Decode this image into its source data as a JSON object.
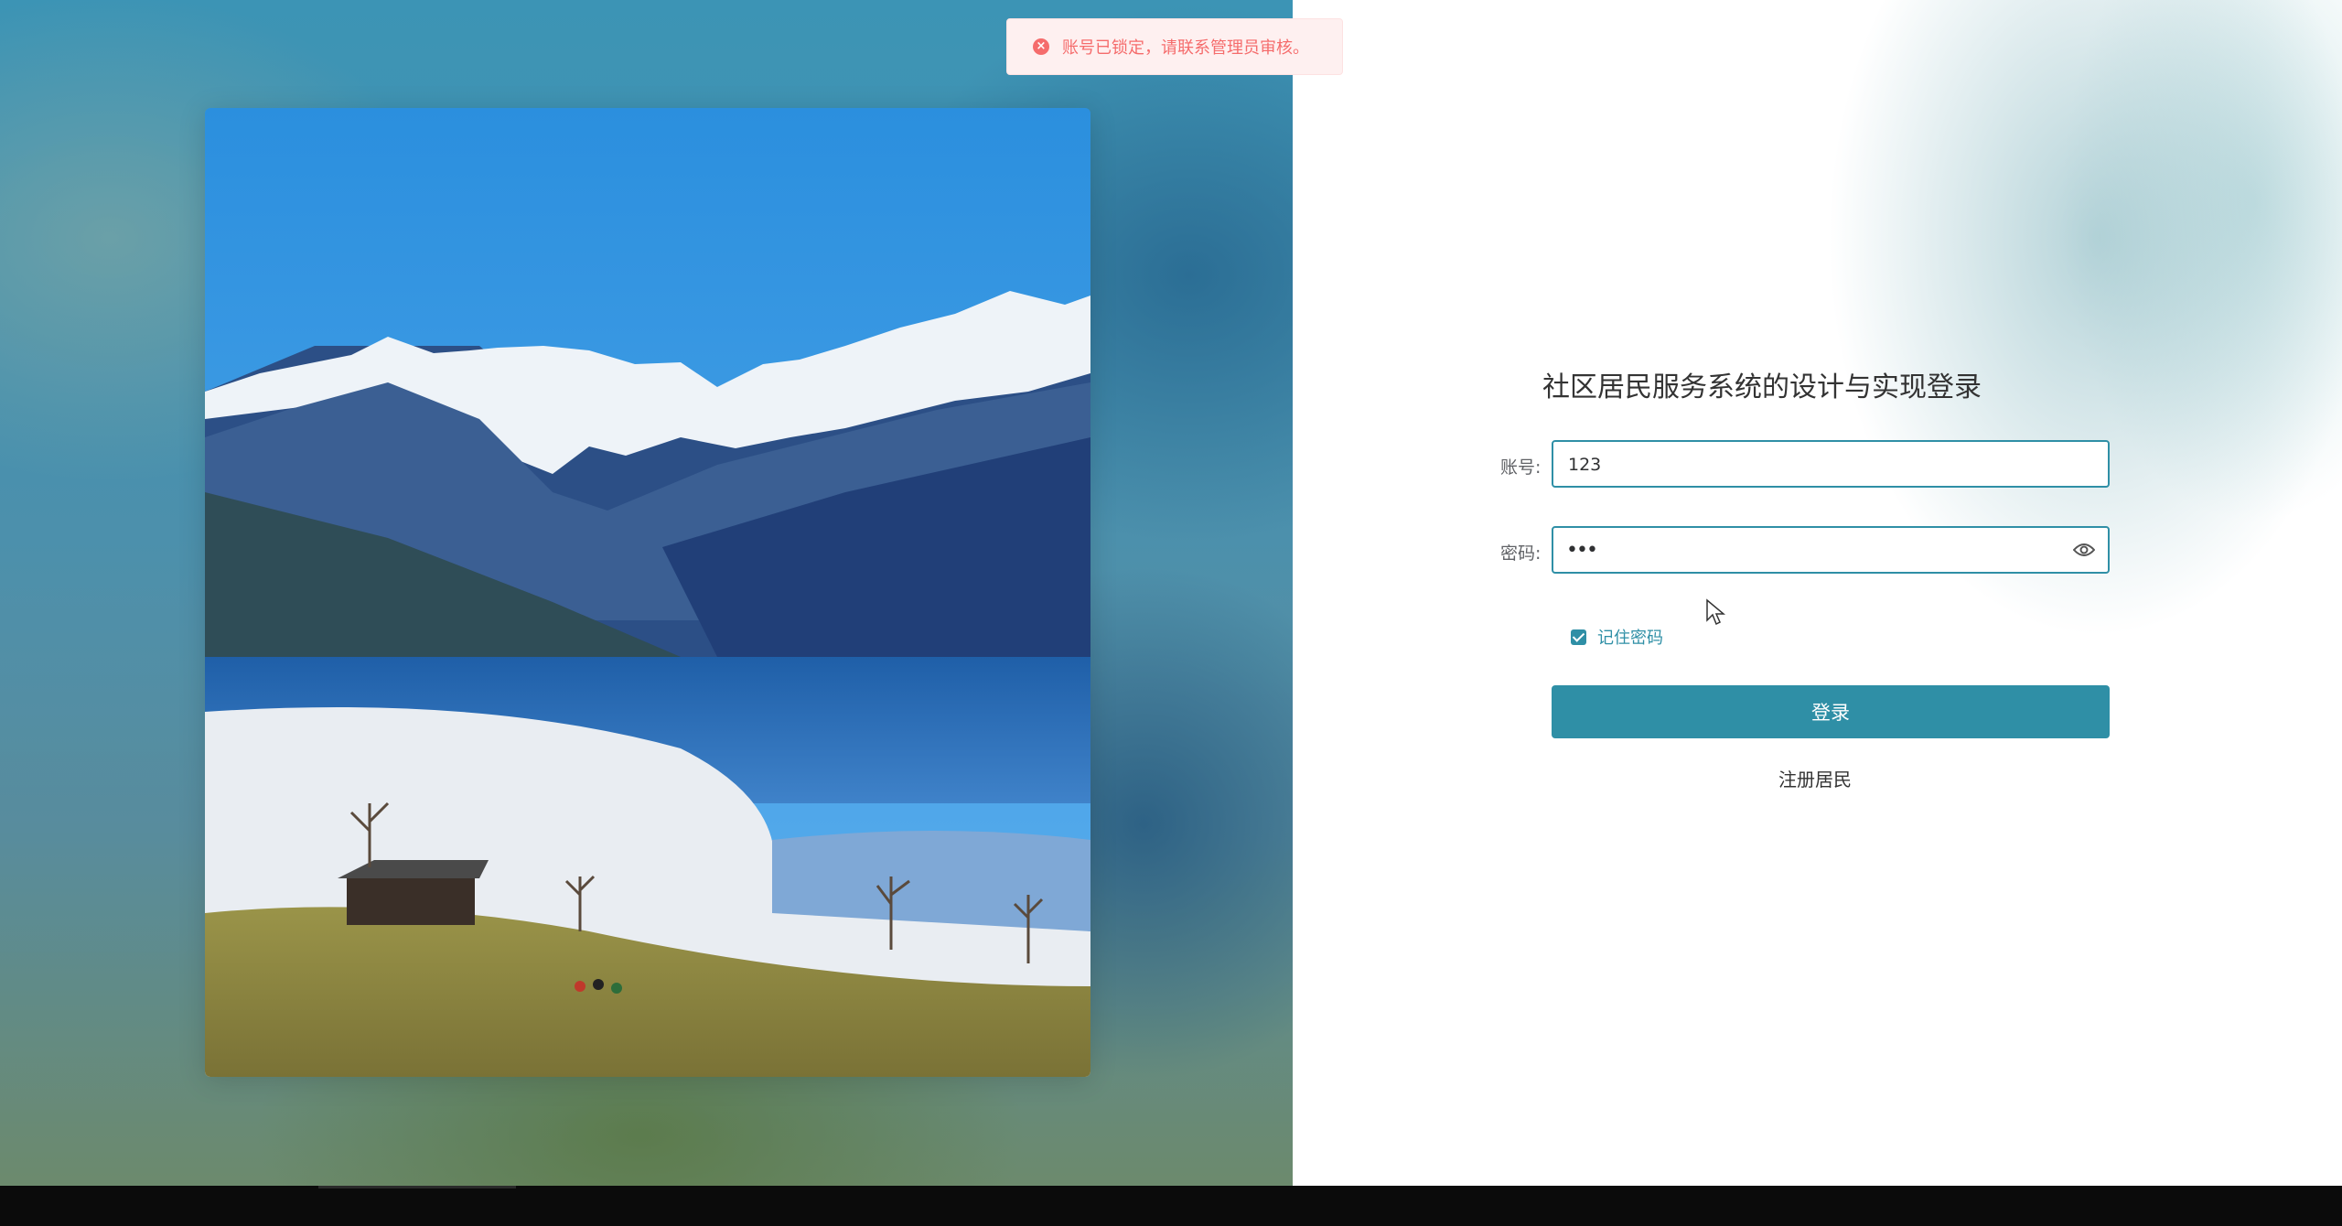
{
  "toast": {
    "icon": "error-circle-icon",
    "message": "账号已锁定，请联系管理员审核。"
  },
  "form": {
    "title": "社区居民服务系统的设计与实现登录",
    "account_label": "账号:",
    "account_value": "123",
    "password_label": "密码:",
    "password_masked": "•••",
    "remember_label": "记住密码",
    "remember_checked": true,
    "login_button": "登录",
    "register_link": "注册居民"
  },
  "colors": {
    "accent": "#2f8fa6",
    "error": "#f56c6c"
  }
}
